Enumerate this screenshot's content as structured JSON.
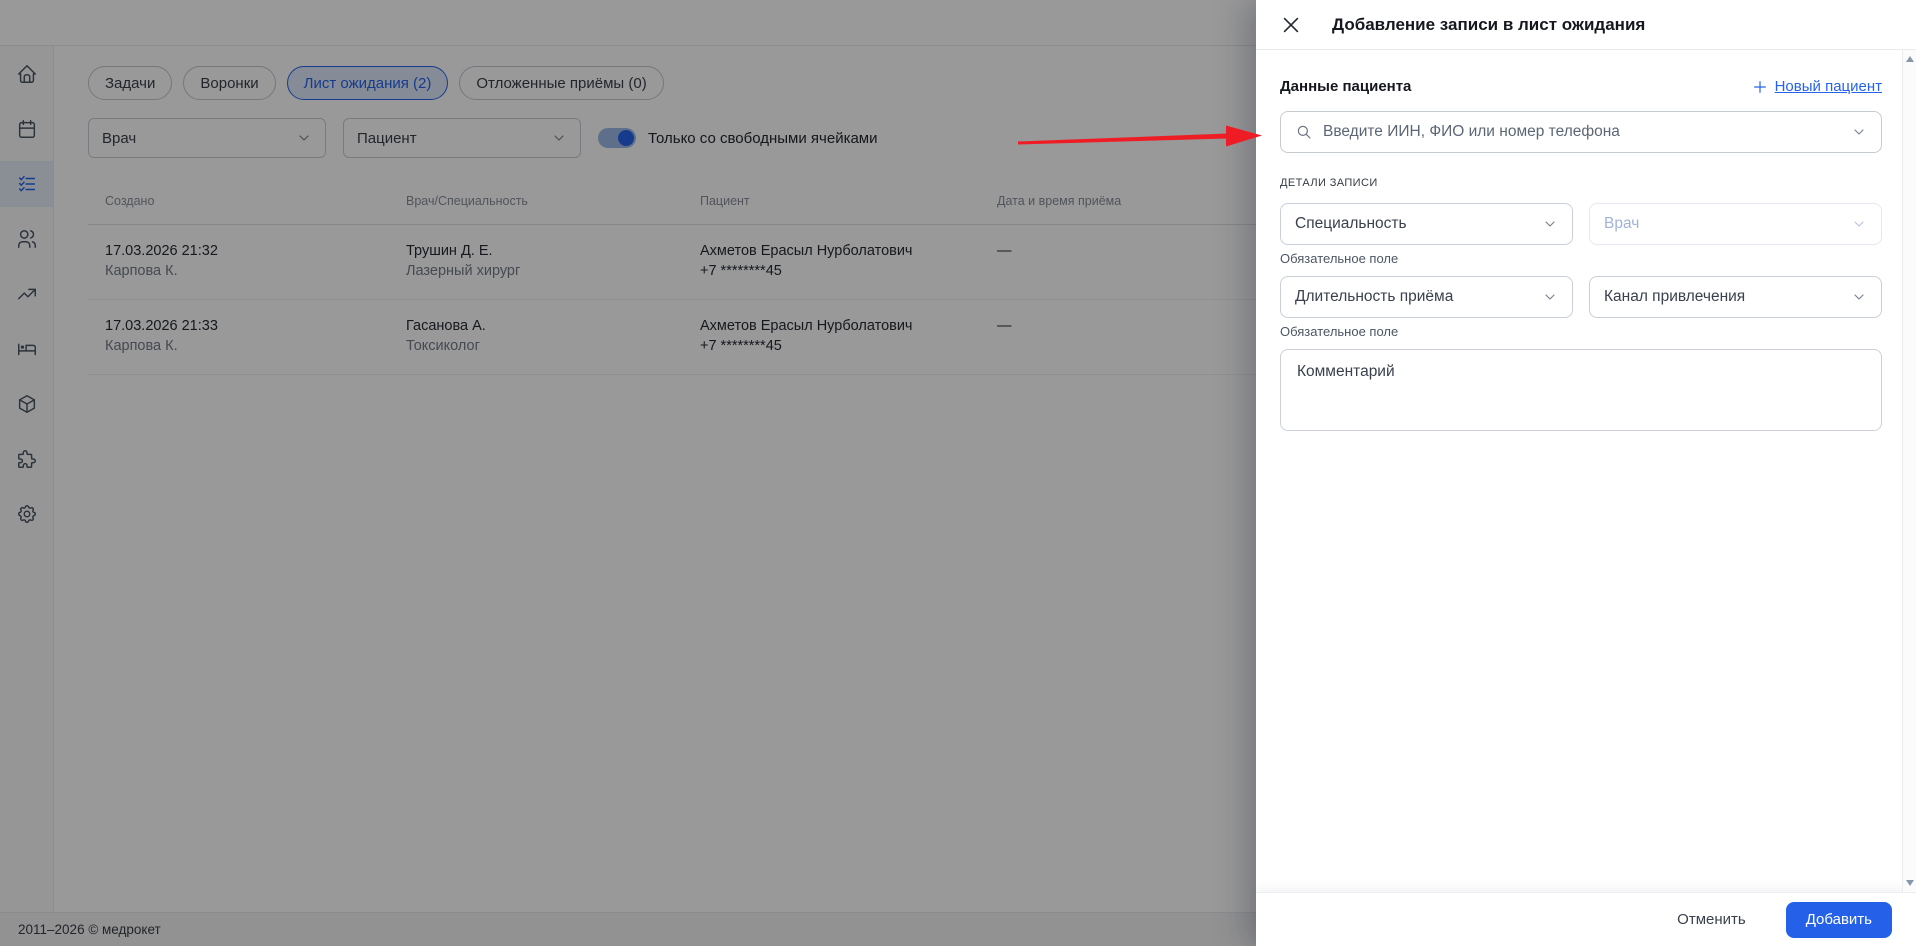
{
  "sidebar": {
    "icons": [
      "home",
      "calendar",
      "checklist",
      "users",
      "trending-up",
      "bed",
      "package",
      "puzzle",
      "gear"
    ],
    "active_index": 2
  },
  "tabs": [
    {
      "label": "Задачи",
      "active": false
    },
    {
      "label": "Воронки",
      "active": false
    },
    {
      "label": "Лист ожидания (2)",
      "active": true
    },
    {
      "label": "Отложенные приёмы (0)",
      "active": false
    }
  ],
  "filters": {
    "doctor_placeholder": "Врач",
    "patient_placeholder": "Пациент",
    "toggle_label": "Только со свободными ячейками",
    "toggle_on": true
  },
  "table": {
    "columns": [
      "Создано",
      "Врач/Специальность",
      "Пациент",
      "Дата и время приёма"
    ],
    "rows": [
      {
        "created_at": "17.03.2026 21:32",
        "created_by": "Карпова К.",
        "doctor": "Трушин Д. Е.",
        "specialty": "Лазерный хирург",
        "patient": "Ахметов Ерасыл Нурболатович",
        "phone": "+7 ********45",
        "appointment": "—"
      },
      {
        "created_at": "17.03.2026 21:33",
        "created_by": "Карпова К.",
        "doctor": "Гасанова А.",
        "specialty": "Токсиколог",
        "patient": "Ахметов Ерасыл Нурболатович",
        "phone": "+7 ********45",
        "appointment": "—"
      }
    ]
  },
  "drawer": {
    "title": "Добавление записи в лист ожидания",
    "patient_section": {
      "heading": "Данные пациента",
      "new_patient_label": "Новый пациент",
      "search_placeholder": "Введите ИИН, ФИО или номер телефона"
    },
    "details": {
      "section_label": "ДЕТАЛИ ЗАПИСИ",
      "specialty_placeholder": "Специальность",
      "doctor_placeholder": "Врач",
      "duration_placeholder": "Длительность приёма",
      "channel_placeholder": "Канал привлечения",
      "required_note": "Обязательное поле",
      "comment_placeholder": "Комментарий"
    },
    "footer": {
      "cancel_label": "Отменить",
      "submit_label": "Добавить"
    }
  },
  "page_footer": {
    "copyright": "2011–2026 © медрокет"
  },
  "colors": {
    "accent": "#2563eb",
    "submit_button": "#2461e8",
    "annotation_arrow": "#ee1d25",
    "overlay": "rgba(0,0,0,0.40)"
  }
}
